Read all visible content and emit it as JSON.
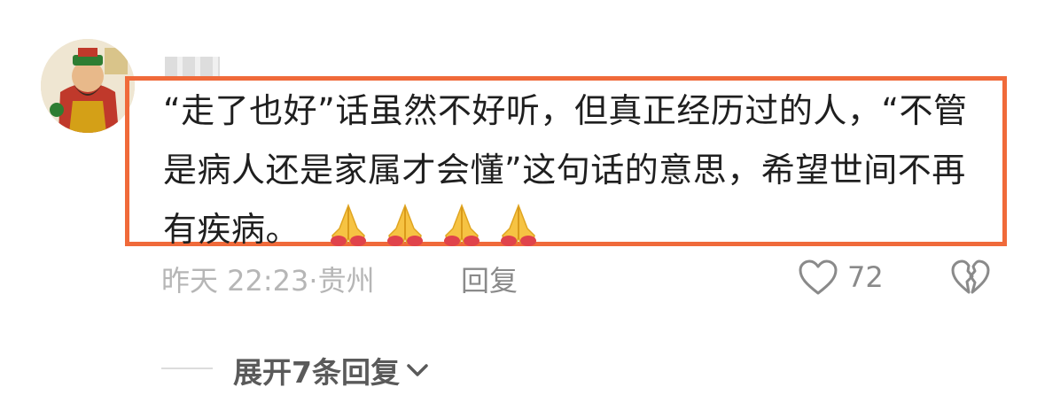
{
  "comment": {
    "text": "“走了也好”话虽然不好听，但真正经历过的人，“不管是病人还是家属才会懂”这句话的意思，希望世间不再有疾病。",
    "emoji": "🙏🙏🙏🙏",
    "emoji_count": 4,
    "timestamp": "昨天 22:23",
    "location": "贵州",
    "separator": "·",
    "reply_label": "回复",
    "like_count": "72"
  },
  "expand_replies": {
    "label": "展开7条回复"
  },
  "colors": {
    "highlight_border": "#f06a3a",
    "text": "#1f1f1f",
    "meta_text": "#b6b6b6",
    "action_text": "#8a8a8a",
    "expand_text": "#5a5a5a"
  },
  "icons": {
    "like": "heart-outline-icon",
    "dislike": "broken-heart-icon",
    "expand": "chevron-down-icon",
    "emoji": "folded-hands-icon"
  }
}
